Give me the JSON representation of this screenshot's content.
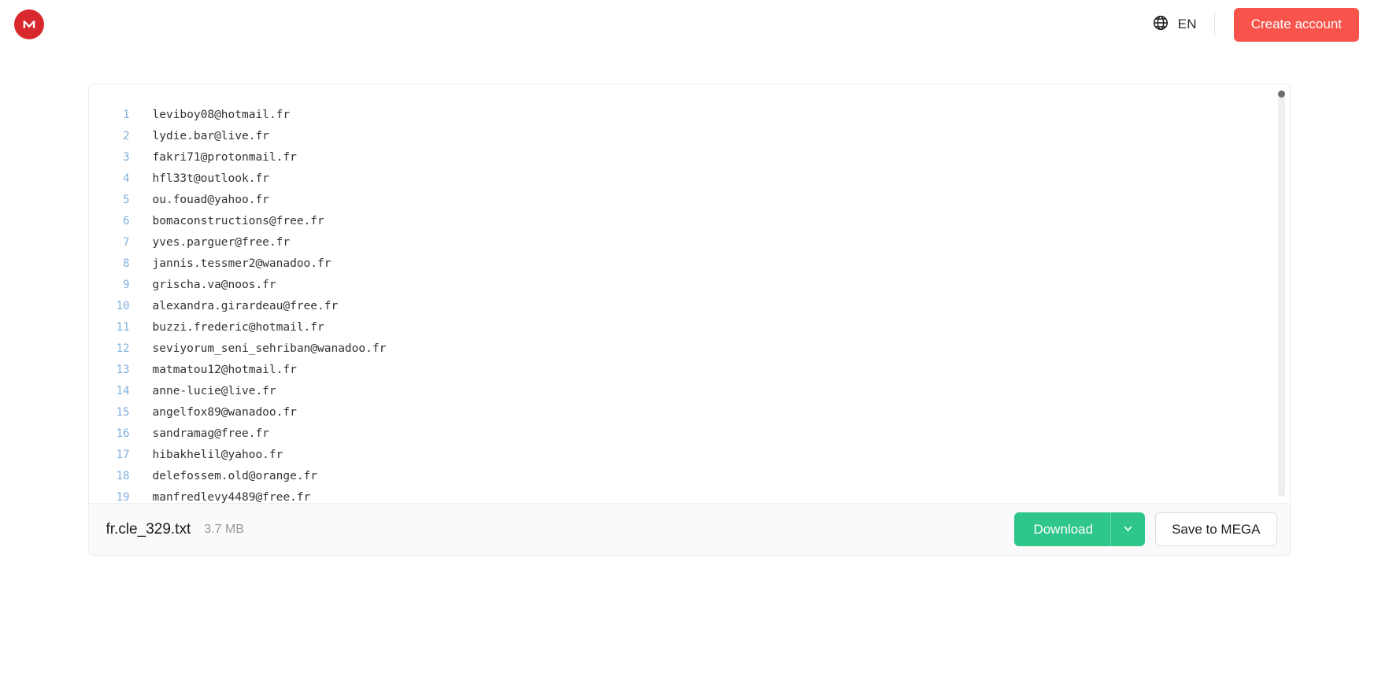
{
  "header": {
    "logo_icon": "mega-logo-icon",
    "logo_color": "#d9272e",
    "globe_icon": "globe-icon",
    "language": "EN",
    "create_account_label": "Create account",
    "create_account_color": "#f9544b"
  },
  "viewer": {
    "lines": [
      {
        "number": "1",
        "text": "leviboy08@hotmail.fr"
      },
      {
        "number": "2",
        "text": "lydie.bar@live.fr"
      },
      {
        "number": "3",
        "text": "fakri71@protonmail.fr"
      },
      {
        "number": "4",
        "text": "hfl33t@outlook.fr"
      },
      {
        "number": "5",
        "text": "ou.fouad@yahoo.fr"
      },
      {
        "number": "6",
        "text": "bomaconstructions@free.fr"
      },
      {
        "number": "7",
        "text": "yves.parguer@free.fr"
      },
      {
        "number": "8",
        "text": "jannis.tessmer2@wanadoo.fr"
      },
      {
        "number": "9",
        "text": "grischa.va@noos.fr"
      },
      {
        "number": "10",
        "text": "alexandra.girardeau@free.fr"
      },
      {
        "number": "11",
        "text": "buzzi.frederic@hotmail.fr"
      },
      {
        "number": "12",
        "text": "seviyorum_seni_sehriban@wanadoo.fr"
      },
      {
        "number": "13",
        "text": "matmatou12@hotmail.fr"
      },
      {
        "number": "14",
        "text": "anne-lucie@live.fr"
      },
      {
        "number": "15",
        "text": "angelfox89@wanadoo.fr"
      },
      {
        "number": "16",
        "text": "sandramag@free.fr"
      },
      {
        "number": "17",
        "text": "hibakhelil@yahoo.fr"
      },
      {
        "number": "18",
        "text": "delefossem.old@orange.fr"
      },
      {
        "number": "19",
        "text": "manfredlevy4489@free.fr"
      }
    ],
    "line_number_color": "#7daedd",
    "text_color": "#2f3337"
  },
  "footer": {
    "filename": "fr.cle_329.txt",
    "filesize": "3.7 MB",
    "download_label": "Download",
    "download_caret_icon": "chevron-down-icon",
    "download_color": "#2fc68b",
    "save_label": "Save to MEGA"
  }
}
